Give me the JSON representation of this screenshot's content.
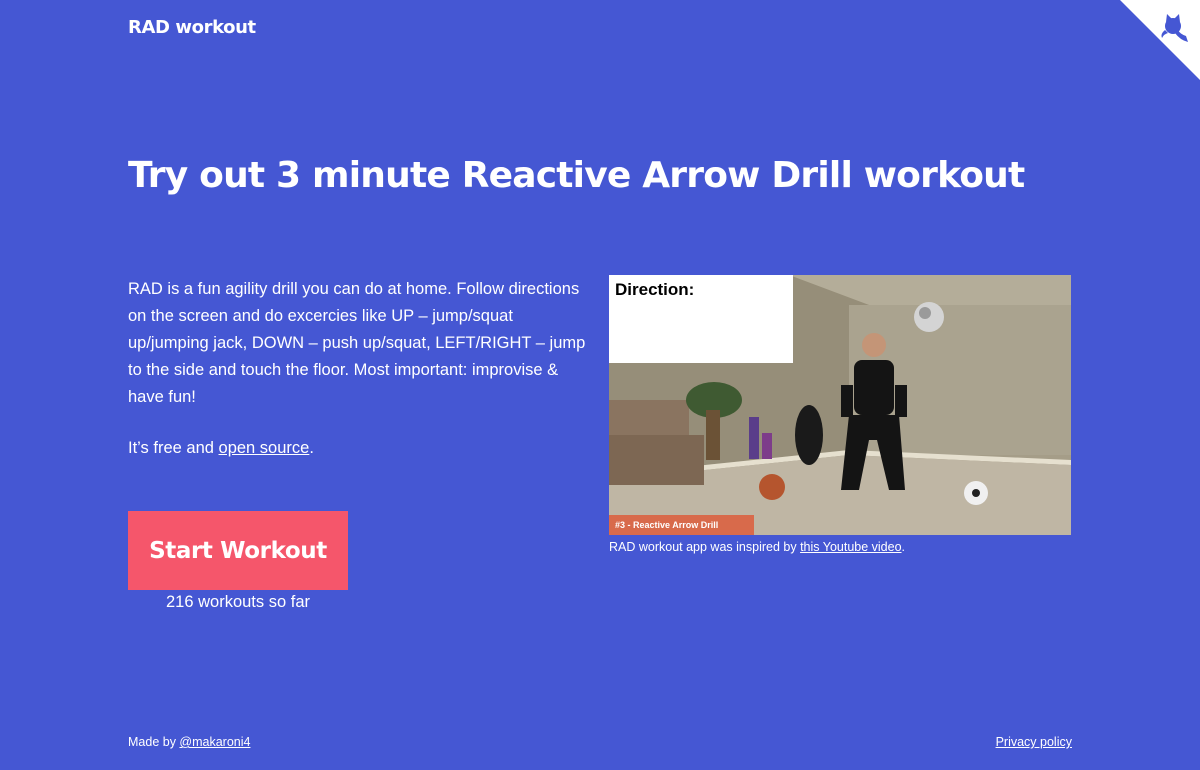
{
  "header": {
    "brand": "RAD workout",
    "corner_icon": "octocat-icon"
  },
  "hero": {
    "title": "Try out 3 minute Reactive Arrow Drill workout"
  },
  "intro": {
    "description": "RAD is a fun agility drill you can do at home. Follow directions on the screen and do excercies like UP – jump/squat up/jumping jack, DOWN – push up/squat, LEFT/RIGHT – jump to the side and touch the floor. Most important: improvise & have fun!",
    "free_prefix": "It’s free and ",
    "free_link": "open source",
    "free_suffix": "."
  },
  "cta": {
    "start_label": "Start Workout",
    "workout_count": "216 workouts so far"
  },
  "video": {
    "direction_label": "Direction:",
    "title_banner": "#3 - Reactive Arrow Drill",
    "caption_prefix": "RAD workout app was inspired by ",
    "caption_link": "this Youtube video",
    "caption_suffix": "."
  },
  "footer": {
    "made_by_prefix": "Made by ",
    "made_by_link": "@makaroni4",
    "privacy_link": "Privacy policy"
  },
  "colors": {
    "background": "#4557d3",
    "button": "#f5566b",
    "text": "#ffffff",
    "corner": "#ffffff"
  }
}
